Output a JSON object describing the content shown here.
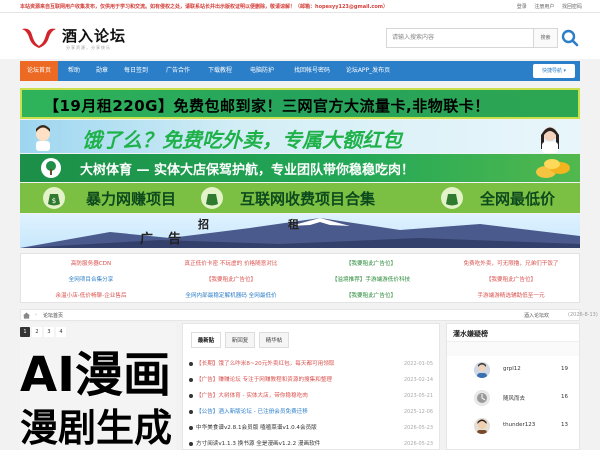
{
  "topbar": {
    "notice": "本站资源来自互联网用户收集发布，仅供用于学习和交流。如有侵权之处，请联系站长并出示版权证明以便删除，敬请谅解！（邮箱：hopesyy123@gmail.com）",
    "links": [
      "登录",
      "注册用户",
      "找回密码"
    ]
  },
  "logo": {
    "name": "酒入论坛",
    "slogan": "分享资源，分享快乐"
  },
  "search": {
    "placeholder": "请输入搜索内容",
    "select": "搜索"
  },
  "nav": {
    "items": [
      "论坛首页",
      "帮助",
      "勋章",
      "每日签到",
      "广告合作",
      "下载教程",
      "电脑防护",
      "找回帐号密码",
      "论坛APP_发布页"
    ],
    "active_index": 0,
    "quick": "快捷导航"
  },
  "banners": {
    "b1": "【19月租220G】免费包邮到家！三网官方大流量卡,非物联卡！",
    "b2": "饿了么？免费吃外卖，专属大额红包",
    "b3": "大树体育 — 实体大店保驾护航，专业团队带你稳稳吃肉！",
    "b4_1": "暴力网赚项目",
    "b4_2": "互联网收费项目合集",
    "b4_3": "全网最低价",
    "b5_1": "广",
    "b5_2": "招",
    "b5_3": "租",
    "b5_4": "告"
  },
  "ad_links": [
    {
      "text": "高防服务器CDN",
      "color": "#d9534f"
    },
    {
      "text": "真正低价卡密 不玩虚的 价格随意对比",
      "color": "#d9534f"
    },
    {
      "text": "【我要租此广告位】",
      "color": "#2a8a3a"
    },
    {
      "text": "免费吃外卖，可无限撸，兄弟们干饭了",
      "color": "#d9534f"
    },
    {
      "text": "全网项目合集分享",
      "color": "#2b7ec8"
    },
    {
      "text": "【我要租此广告位】",
      "color": "#d9534f"
    },
    {
      "text": "【溢境推荐】手游端游低价科技",
      "color": "#2a8a3a"
    },
    {
      "text": "【我要租此广告位】",
      "color": "#d9534f"
    },
    {
      "text": "余温小店-低价畅聊-企业售后",
      "color": "#d9534f"
    },
    {
      "text": "全网内部最稳定解机器码 全网最低价",
      "color": "#2b7ec8"
    },
    {
      "text": "【我要租此广告位】",
      "color": "#2a8a3a"
    },
    {
      "text": "手游端游精选辅助低至一元",
      "color": "#d9534f"
    }
  ],
  "crumbs": {
    "here": "论坛首页",
    "welcome": "酒入论坛欢",
    "date": "(2026-8-13)"
  },
  "slider": {
    "dots": [
      "1",
      "2",
      "3",
      "4"
    ],
    "active": 0,
    "line1": "AI漫画",
    "line2": "漫剧生成"
  },
  "threads": {
    "tabs": [
      "最新贴",
      "新回复",
      "精华帖"
    ],
    "rows": [
      {
        "title": "【长期】饿了么咋米8~20元外卖红包，每天都可用领取",
        "date": "2022-01-05",
        "color": "#d9534f"
      },
      {
        "title": "【广告】赚赚论坛 专注于网赚教程和资源的搜集和整理",
        "date": "2023-02-14",
        "color": "#d9534f"
      },
      {
        "title": "【广告】大树体育 - 实体大店，带你稳稳吃肉",
        "date": "2023-05-21",
        "color": "#d9534f"
      },
      {
        "title": "【公告】酒入新版论坛 - 已注册会员免费迁移",
        "date": "2025-12-06",
        "color": "#2b7ec8"
      },
      {
        "title": "中华美食谱v2.8.1会员版 嗑嗑菜谱v1.0.4会员版",
        "date": "2026-05-23",
        "color": "#333333"
      },
      {
        "title": "方寸阅读v1.1.3 换书源 全是漫画v1.2.2 漫画软件",
        "date": "2026-05-23",
        "color": "#333333"
      }
    ]
  },
  "rank": {
    "title": "灌水嫌疑榜",
    "users": [
      {
        "name": "grpl12",
        "count": "19"
      },
      {
        "name": "随风而去",
        "count": "16"
      },
      {
        "name": "thunder123",
        "count": "13"
      }
    ]
  }
}
